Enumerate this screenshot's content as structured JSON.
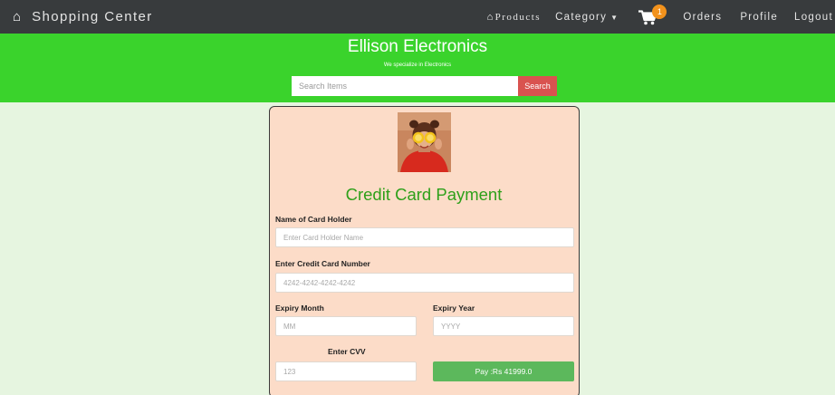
{
  "navbar": {
    "brand": "Shopping Center",
    "products_label": "Products",
    "category_label": "Category",
    "cart_count": "1",
    "orders_label": "Orders",
    "profile_label": "Profile",
    "logout_label": "Logout"
  },
  "header": {
    "title": "Ellison Electronics",
    "tagline": "We specialize in Electronics",
    "search_placeholder": "Search Items",
    "search_button": "Search"
  },
  "payment": {
    "title": "Credit Card Payment",
    "card_holder_label": "Name of Card Holder",
    "card_holder_placeholder": "Enter Card Holder Name",
    "card_number_label": "Enter Credit Card Number",
    "card_number_placeholder": "4242-4242-4242-4242",
    "expiry_month_label": "Expiry Month",
    "expiry_month_placeholder": "MM",
    "expiry_year_label": "Expiry Year",
    "expiry_year_placeholder": "YYYY",
    "cvv_label": "Enter CVV",
    "cvv_placeholder": "123",
    "pay_button": "Pay :Rs 41999.0"
  },
  "icons": {
    "brand_icon": "home-icon",
    "products_icon": "home-icon",
    "category_caret": "caret-down-icon",
    "cart_icon": "shopping-cart-icon"
  },
  "colors": {
    "navbar_bg": "#383b3d",
    "header_bg": "#3ad32c",
    "page_bg": "#e6f5e0",
    "card_bg": "#fcdcc8",
    "title_green": "#2ea01a",
    "search_button_bg": "#d9534f",
    "pay_button_bg": "#5cb85c",
    "cart_badge": "#f2921c"
  }
}
